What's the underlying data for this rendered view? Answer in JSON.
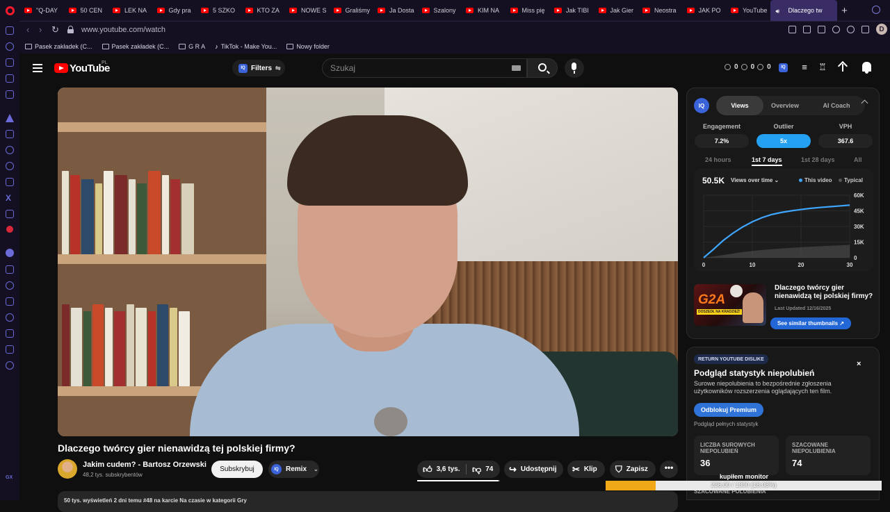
{
  "browser": {
    "tabs": [
      {
        "label": "\"Q-DAY"
      },
      {
        "label": "50 CEN"
      },
      {
        "label": "LEK NA"
      },
      {
        "label": "Gdy pra"
      },
      {
        "label": "5 SZKO"
      },
      {
        "label": "KTO ZA"
      },
      {
        "label": "NOWE S"
      },
      {
        "label": "Graliśmy"
      },
      {
        "label": "Ja Dosta"
      },
      {
        "label": "Szalony"
      },
      {
        "label": "KIM NA"
      },
      {
        "label": "Miss pię"
      },
      {
        "label": "Jak TIBI"
      },
      {
        "label": "Jak Gier"
      },
      {
        "label": "Neostra"
      },
      {
        "label": "JAK PO"
      },
      {
        "label": "YouTube"
      }
    ],
    "active_tab": "Dlaczego tw",
    "new_tab_label": "+",
    "url": "www.youtube.com/watch",
    "profile_initial": "D",
    "bookmarks": [
      {
        "label": "Pasek zakładek (C...",
        "icon": "folder-icon"
      },
      {
        "label": "Pasek zakładek (C...",
        "icon": "folder-icon"
      },
      {
        "label": "G R A",
        "icon": "folder-icon"
      },
      {
        "label": "TikTok - Make You...",
        "icon": "tiktok-icon"
      },
      {
        "label": "Nowy folder",
        "icon": "folder-icon"
      }
    ],
    "sidebar_badge": "GX"
  },
  "youtube": {
    "wordmark": "YouTube",
    "country": "PL",
    "filters_label": "Filters",
    "search_placeholder": "Szukaj",
    "header_stats": [
      "0",
      "0",
      "0"
    ],
    "iq_badge": "IQ"
  },
  "video": {
    "title": "Dlaczego twórcy gier nienawidzą tej polskiej firmy?",
    "channel_name": "Jakim cudem? - Bartosz Orzewski",
    "channel_subs": "48,2 tys. subskrybentów",
    "subscribe_label": "Subskrybuj",
    "remix_label": "Remix",
    "likes": "3,6 tys.",
    "dislikes": "74",
    "like_ratio": 0.98,
    "share_label": "Udostępnij",
    "clip_label": "Klip",
    "save_label": "Zapisz",
    "more_label": "•••",
    "description_preview": "50 tys. wyświetleń  2 dni temu  #48 na karcie Na czasie w kategorii Gry"
  },
  "iq_panel": {
    "logo": "IQ",
    "tabs": [
      "Views",
      "Overview",
      "AI Coach"
    ],
    "active_tab": 0,
    "metrics": [
      {
        "label": "Engagement",
        "value": "7.2%"
      },
      {
        "label": "Outlier",
        "value": "5x"
      },
      {
        "label": "VPH",
        "value": "367.6"
      }
    ],
    "ranges": [
      "24 hours",
      "1st 7 days",
      "1st 28 days",
      "All"
    ],
    "active_range": 1,
    "views_total": "50.5K",
    "views_dropdown": "Views over time ⌄",
    "legend_this": "This video",
    "legend_typical": "Typical",
    "this_color": "#3ea6ff",
    "typical_color": "#555555",
    "thumb_title": "Dlaczego twórcy gier nienawidzą tej polskiej firmy?",
    "thumb_updated": "Last Updated 12/16/2025",
    "thumb_button": "See similar thumbnails ↗",
    "thumb_overlay_main": "G2A",
    "thumb_overlay_sub": "DOSZEDŁ NA KRADZIEŻ!"
  },
  "chart_data": {
    "type": "area",
    "x": [
      0,
      2,
      4,
      6,
      8,
      10,
      12,
      14,
      16,
      18,
      20,
      22,
      24,
      26,
      28,
      30
    ],
    "series": [
      {
        "name": "This video",
        "values": [
          0,
          8000,
          16500,
          23500,
          29500,
          34500,
          38500,
          41500,
          43500,
          45000,
          46300,
          47400,
          48300,
          49000,
          49700,
          50500
        ]
      },
      {
        "name": "Typical",
        "values": [
          0,
          1200,
          2600,
          4000,
          5400,
          6500,
          7400,
          8200,
          8900,
          9500,
          10100,
          10600,
          11100,
          11500,
          11900,
          12300
        ]
      }
    ],
    "x_ticks": [
      "0",
      "10",
      "20",
      "30"
    ],
    "x_tick_values": [
      0,
      10,
      20,
      30
    ],
    "y_ticks": [
      "60K",
      "45K",
      "30K",
      "15K",
      "0"
    ],
    "y_tick_values": [
      60000,
      45000,
      30000,
      15000,
      0
    ],
    "xlim": [
      0,
      30
    ],
    "ylim": [
      0,
      60000
    ],
    "grid": true,
    "legend": "top-right"
  },
  "dislike_panel": {
    "badge": "RETURN YOUTUBE DISLIKE",
    "close": "×",
    "title": "Podgląd statystyk niepolubień",
    "description": "Surowe niepolubienia to bezpośrednie zgłoszenia użytkowników rozszerzenia oglądających ten film.",
    "premium_button": "Odblokuj Premium",
    "full_stats": "Podgląd pełnych statystyk",
    "raw_label": "LICZBA SUROWYCH NIEPOLUBIEŃ",
    "raw_value": "36",
    "est_label": "SZACOWANE NIEPOLUBIENIA",
    "est_value": "74",
    "more_label": "SZACOWANE POLUBIENIA"
  },
  "overlay": {
    "label": "kupiłem monitor",
    "progress_text": "236.00 / 1300 (18.08%)",
    "progress": 0.1808
  }
}
